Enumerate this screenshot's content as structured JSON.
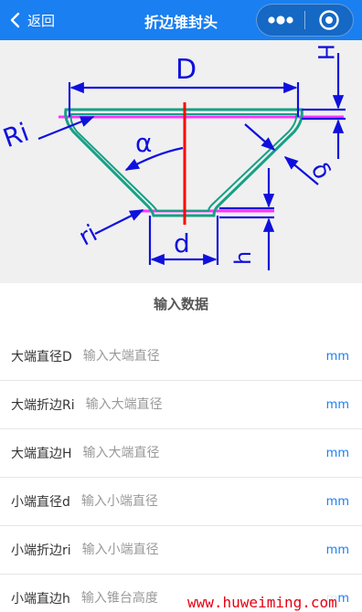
{
  "nav": {
    "back_label": "返回",
    "title": "折边锥封头",
    "background": "#1a7ff0",
    "icons": {
      "back": "chevron-left-icon",
      "more": "more-dots-icon",
      "close": "target-circle-icon"
    }
  },
  "diagram": {
    "labels": {
      "D": "D",
      "H": "H",
      "Ri": "Ri",
      "alpha": "α",
      "delta": "δ",
      "ri": "ri",
      "d": "d",
      "h": "h"
    }
  },
  "section": {
    "title": "输入数据"
  },
  "fields": [
    {
      "label": "大端直径D",
      "placeholder": "输入大端直径",
      "unit": "mm"
    },
    {
      "label": "大端折边Ri",
      "placeholder": "输入大端直径",
      "unit": "mm"
    },
    {
      "label": "大端直边H",
      "placeholder": "输入大端直径",
      "unit": "mm"
    },
    {
      "label": "小端直径d",
      "placeholder": "输入小端直径",
      "unit": "mm"
    },
    {
      "label": "小端折边ri",
      "placeholder": "输入小端直径",
      "unit": "mm"
    },
    {
      "label": "小端直边h",
      "placeholder": "输入锥台高度",
      "unit": "mm"
    }
  ],
  "watermark": "www.huweiming.com",
  "colors": {
    "accent": "#1a7ff0",
    "dimension": "#1010dd",
    "shell": "#16a085",
    "axis": "#ff0000",
    "centerline": "#ff00ff"
  }
}
